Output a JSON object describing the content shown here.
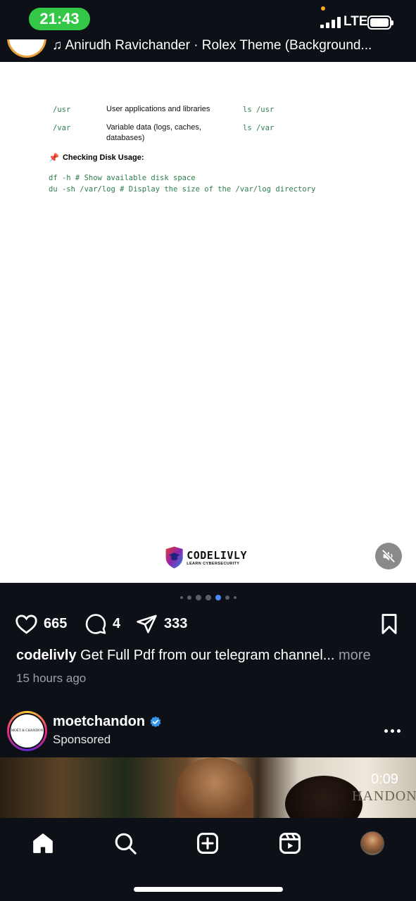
{
  "status_bar": {
    "time": "21:43",
    "network": "LTE"
  },
  "post": {
    "audio_line": "♫ Anirudh Ravichander · Rolex Theme (Background...",
    "document": {
      "rows": [
        {
          "path": "/usr",
          "description": "User applications and libraries",
          "command": "ls /usr"
        },
        {
          "path": "/var",
          "description": "Variable data (logs, caches, databases)",
          "command": "ls /var"
        }
      ],
      "section_heading": "Checking Disk Usage:",
      "code_lines": [
        "df -h # Show available disk space",
        "du -sh /var/log # Display the size of the /var/log directory"
      ]
    },
    "logo": {
      "name": "CODELIVLY",
      "tagline": "LEARN CYBERSECURITY"
    },
    "carousel": {
      "total": 7,
      "active_index": 4
    },
    "actions": {
      "likes": "665",
      "comments": "4",
      "shares": "333"
    },
    "caption": {
      "username": "codelivly",
      "text": "Get Full Pdf from our telegram channel...",
      "more": "more"
    },
    "time_ago": "15 hours ago"
  },
  "next_post": {
    "avatar_text": "MOËT & CHANDON",
    "username": "moetchandon",
    "verified": true,
    "sponsored": "Sponsored",
    "video_duration": "0:09",
    "media_brand_text": "HANDON"
  },
  "bottom_nav": {
    "items": [
      "home-icon",
      "search-icon",
      "create-icon",
      "reels-icon",
      "profile-avatar"
    ]
  },
  "colors": {
    "background": "#0d1117",
    "time_pill": "#33c748",
    "code_green": "#2e7d4e",
    "verified_blue": "#3797f0",
    "dot_active": "#4a8cff"
  }
}
